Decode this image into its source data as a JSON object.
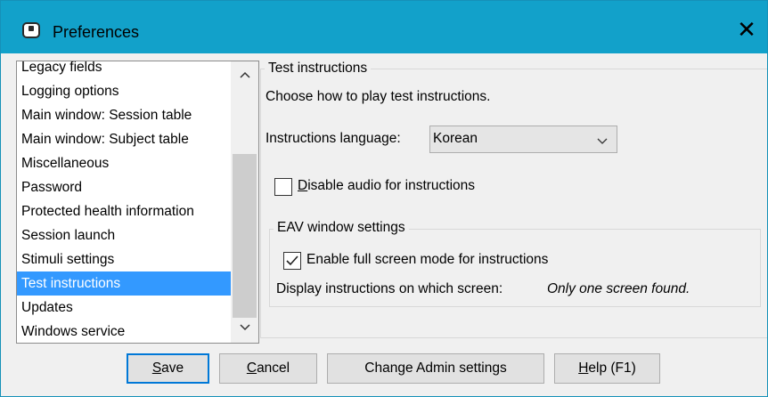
{
  "window": {
    "title": "Preferences",
    "close_glyph": "✕",
    "app_icon": "app-window-icon"
  },
  "sidebar": {
    "items": [
      {
        "label": "Legacy fields",
        "selected": false
      },
      {
        "label": "Logging options",
        "selected": false
      },
      {
        "label": "Main window: Session table",
        "selected": false
      },
      {
        "label": "Main window: Subject table",
        "selected": false
      },
      {
        "label": "Miscellaneous",
        "selected": false
      },
      {
        "label": "Password",
        "selected": false
      },
      {
        "label": "Protected health information",
        "selected": false
      },
      {
        "label": "Session launch",
        "selected": false
      },
      {
        "label": "Stimuli settings",
        "selected": false
      },
      {
        "label": "Test instructions",
        "selected": true
      },
      {
        "label": "Updates",
        "selected": false
      },
      {
        "label": "Windows service",
        "selected": false
      }
    ],
    "scroll_up_glyph": "▲",
    "scroll_down_glyph": "▼"
  },
  "panel": {
    "legend": "Test instructions",
    "description": "Choose how to play test instructions.",
    "language_label": "Instructions language:",
    "language_value": "Korean",
    "disable_audio": {
      "mnemonic": "D",
      "rest": "isable audio for instructions",
      "checked": false
    },
    "eav": {
      "legend": "EAV window settings",
      "full_screen_label": "Enable full screen mode for instructions",
      "full_screen_checked": true,
      "display_label": "Display instructions on which screen:",
      "display_value": "Only one screen found."
    }
  },
  "buttons": {
    "save": {
      "mnemonic": "S",
      "rest": "ave"
    },
    "cancel": {
      "mnemonic": "C",
      "rest": "ancel"
    },
    "admin": "Change Admin settings",
    "help": {
      "mnemonic": "H",
      "rest": "elp (F1)"
    }
  },
  "colors": {
    "titlebar": "#12a1ca",
    "selection": "#3399ff",
    "default_button_border": "#0078d7"
  }
}
